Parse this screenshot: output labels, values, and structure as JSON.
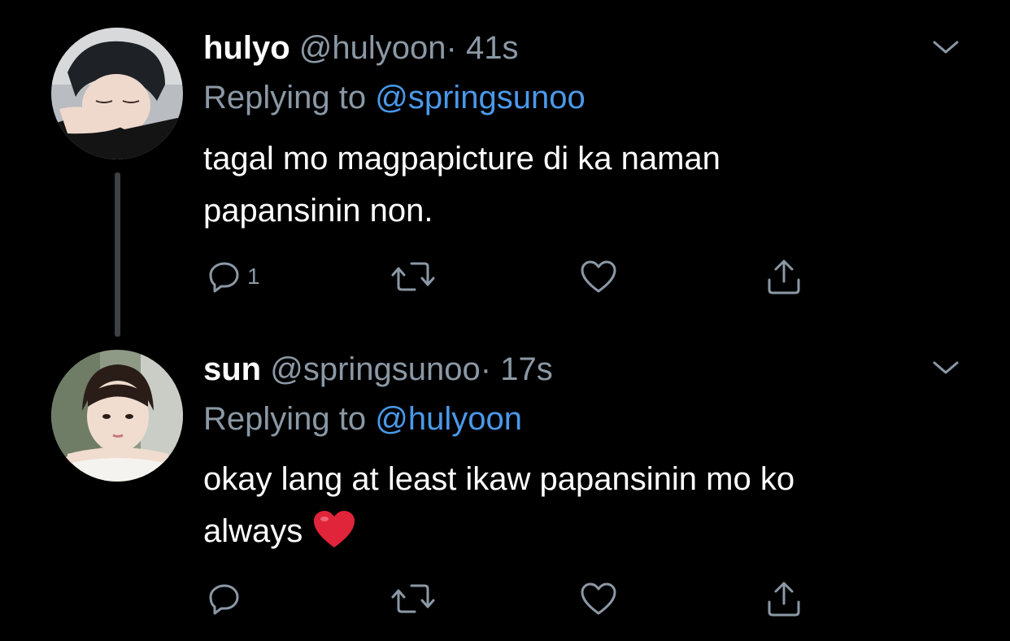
{
  "tweets": [
    {
      "name": "hulyo",
      "handle": "@hulyoon",
      "time": "· 41s",
      "replying_prefix": "Replying to",
      "replying_to": "@springsunoo",
      "text_lines": [
        "tagal mo magpapicture di ka naman",
        "papansinin non."
      ],
      "reply_count": "1",
      "avatar_icon": "avatar-photo-sleeping-person",
      "reply_icon": "reply-icon",
      "retweet_icon": "retweet-icon",
      "like_icon": "heart-icon",
      "share_icon": "share-icon",
      "menu_icon": "chevron-down-icon"
    },
    {
      "name": "sun",
      "handle": "@springsunoo",
      "time": "· 17s",
      "replying_prefix": "Replying to",
      "replying_to": "@hulyoon",
      "text_lines": [
        "okay lang at least ikaw papansinin mo ko",
        "always"
      ],
      "emoji": "❤️",
      "reply_count": "",
      "avatar_icon": "avatar-photo-person-selfie",
      "reply_icon": "reply-icon",
      "retweet_icon": "retweet-icon",
      "like_icon": "heart-icon",
      "share_icon": "share-icon",
      "menu_icon": "chevron-down-icon"
    }
  ],
  "colors": {
    "background": "#000000",
    "text_primary": "#ffffff",
    "text_secondary": "#8b98a5",
    "link": "#4a99e9",
    "thread_line": "#3d4044",
    "heart_emoji": "#e0243a"
  }
}
